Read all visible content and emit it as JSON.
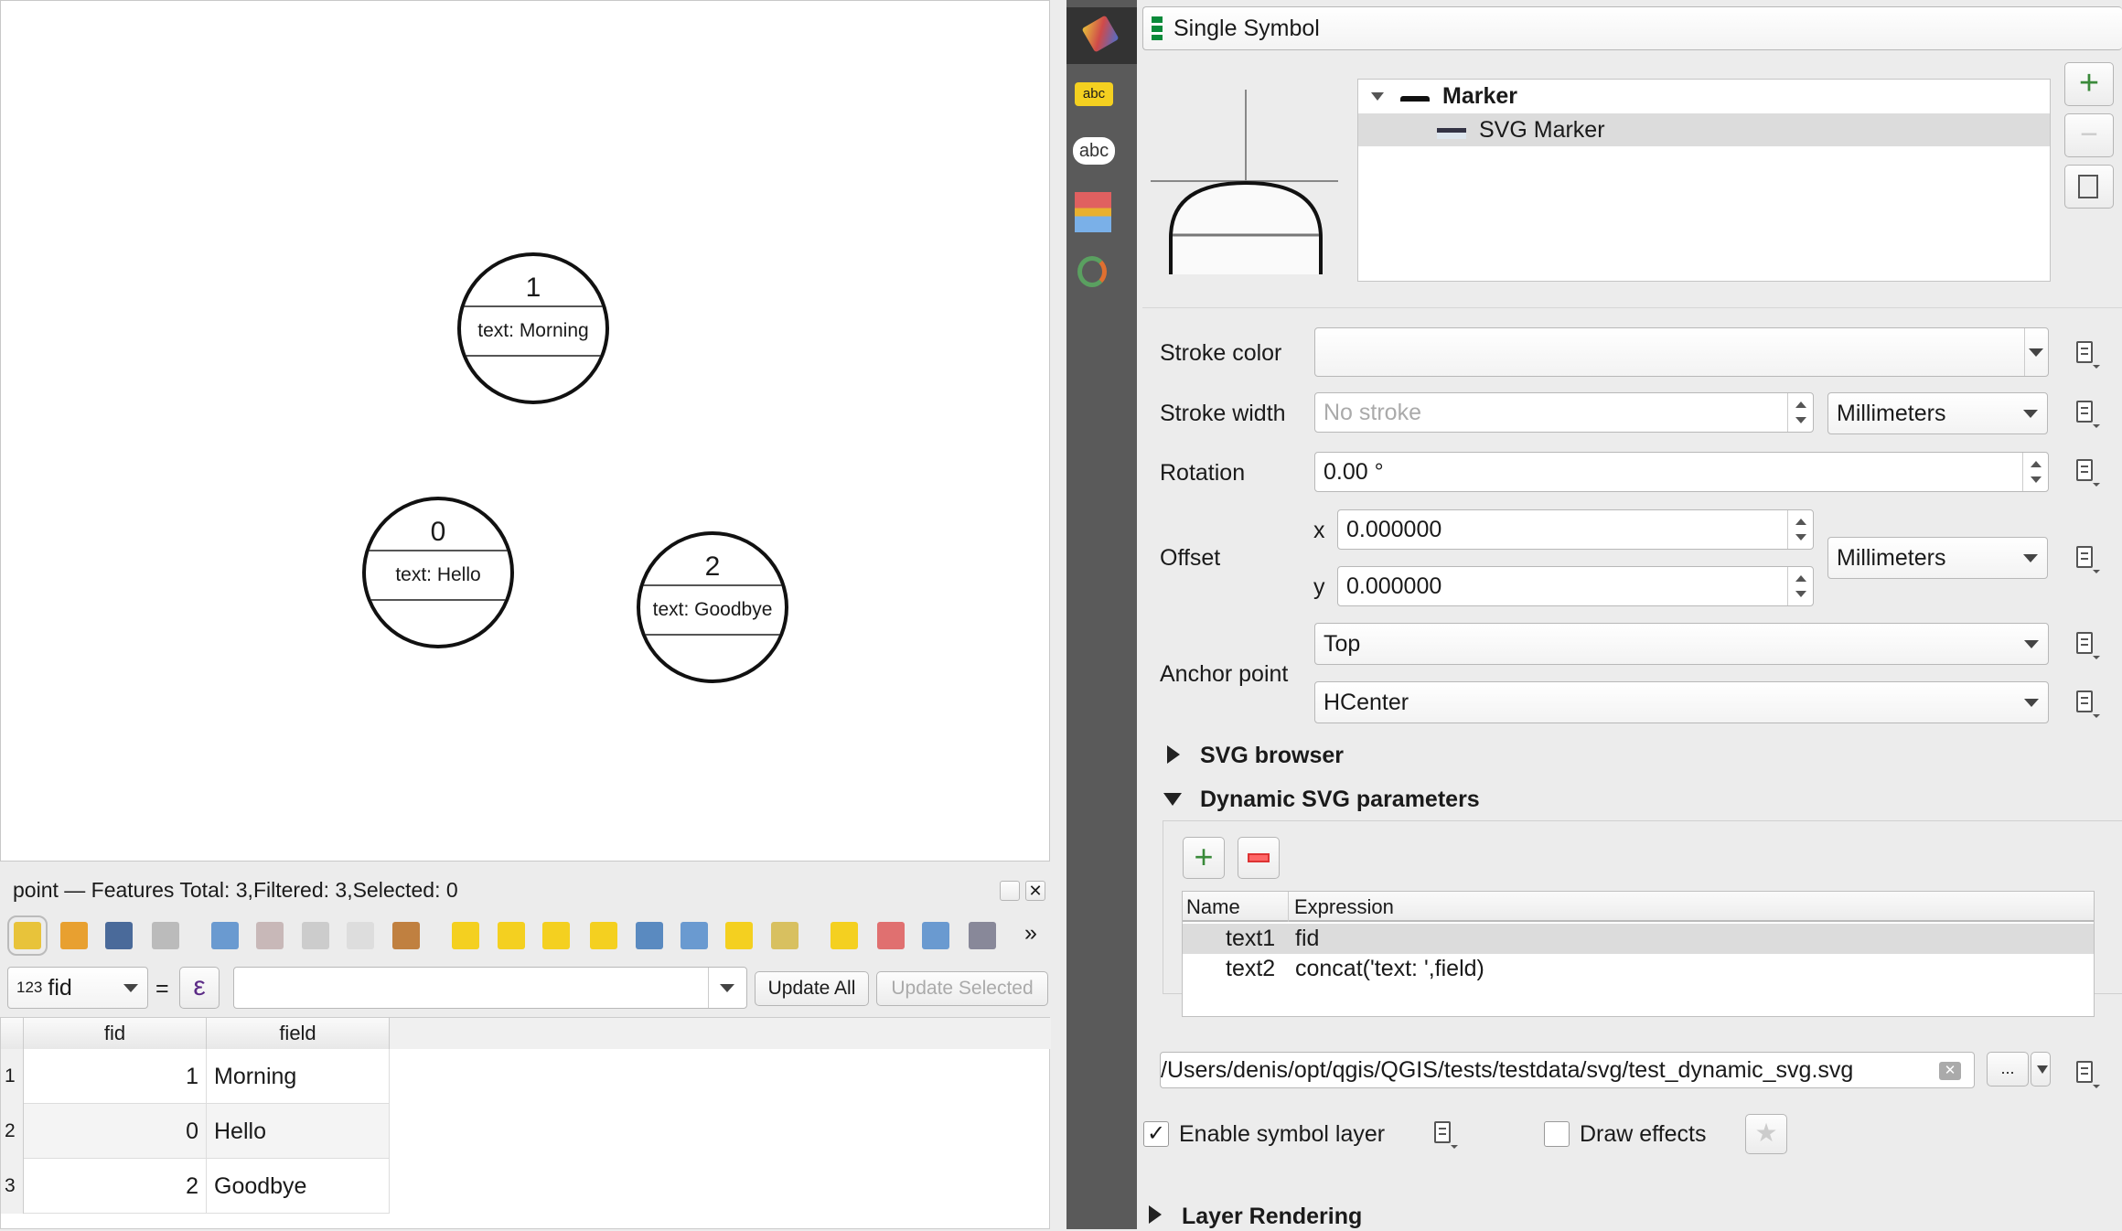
{
  "map": {
    "features": [
      {
        "num": "1",
        "text": "text: Morning"
      },
      {
        "num": "0",
        "text": "text: Hello"
      },
      {
        "num": "2",
        "text": "text: Goodbye"
      }
    ]
  },
  "attribute_table": {
    "title": "point — Features Total: 3,Filtered: 3,Selected: 0",
    "toolbar": {
      "icons": [
        "toggle-editing-icon",
        "multi-edit-icon",
        "save-edits-icon",
        "reload-icon",
        "add-feature-icon",
        "delete-feature-icon",
        "cut-icon",
        "copy-icon",
        "paste-icon",
        "select-by-expression-icon",
        "select-all-icon",
        "invert-selection-icon",
        "deselect-icon",
        "filter-selected-icon",
        "move-selection-top-icon",
        "pan-to-selected-icon",
        "zoom-to-selected-icon",
        "new-field-icon",
        "delete-field-icon",
        "field-calculator-icon",
        "conditional-formatting-icon"
      ],
      "more": "»"
    },
    "field_type": "123",
    "field_select": "fid",
    "equals": "=",
    "epsilon": "ε",
    "expression_value": "",
    "update_all": "Update All",
    "update_selected": "Update Selected",
    "columns": [
      "fid",
      "field"
    ],
    "rows": [
      {
        "n": "1",
        "fid": "1",
        "field": "Morning"
      },
      {
        "n": "2",
        "fid": "0",
        "field": "Hello"
      },
      {
        "n": "3",
        "fid": "2",
        "field": "Goodbye"
      }
    ]
  },
  "symbology": {
    "renderer": "Single Symbol",
    "tree": {
      "root": "Marker",
      "child": "SVG Marker"
    },
    "stroke_color_label": "Stroke color",
    "stroke_width_label": "Stroke width",
    "stroke_width_placeholder": "No stroke",
    "stroke_width_unit": "Millimeters",
    "rotation_label": "Rotation",
    "rotation_value": "0.00 °",
    "offset_label": "Offset",
    "offset_x_label": "x",
    "offset_x": "0.000000",
    "offset_y_label": "y",
    "offset_y": "0.000000",
    "offset_unit": "Millimeters",
    "anchor_label": "Anchor point",
    "anchor_v": "Top",
    "anchor_h": "HCenter",
    "svg_browser": "SVG browser",
    "dynamic_params": "Dynamic SVG parameters",
    "params_columns": [
      "Name",
      "Expression"
    ],
    "params": [
      {
        "name": "text1",
        "expr": "fid"
      },
      {
        "name": "text2",
        "expr": "concat('text: ',field)"
      }
    ],
    "svg_path": "/Users/denis/opt/qgis/QGIS/tests/testdata/svg/test_dynamic_svg.svg",
    "browse": "...",
    "enable_layer": "Enable symbol layer",
    "enable_checked": true,
    "draw_effects": "Draw effects",
    "draw_effects_checked": false,
    "layer_rendering": "Layer Rendering"
  }
}
